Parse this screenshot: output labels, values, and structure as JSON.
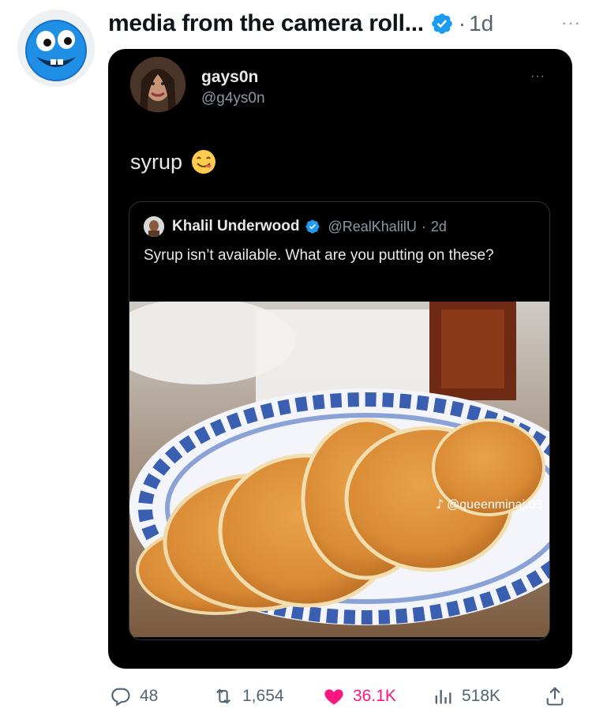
{
  "header": {
    "title": "media from the camera roll...",
    "separator": "·",
    "time": "1d",
    "more": "···"
  },
  "inner_post": {
    "display_name": "gays0n",
    "handle": "@g4ys0n",
    "more": "···",
    "text": "syrup"
  },
  "quoted_post": {
    "display_name": "Khalil Underwood",
    "handle": "@RealKhalilU",
    "separator": "·",
    "time": "2d",
    "text": "Syrup isn’t available. What are you putting on these?",
    "watermark": "@queenminaj.03"
  },
  "actions": {
    "replies": "48",
    "reposts": "1,654",
    "likes": "36.1K",
    "views": "518K"
  },
  "colors": {
    "accent": "#1d9bf0",
    "like": "#f91880",
    "muted": "#536471"
  },
  "icons": [
    "smiley-blue-avatar-icon",
    "verified-badge-icon",
    "more-icon",
    "reply-icon",
    "repost-icon",
    "heart-icon",
    "views-icon",
    "share-icon",
    "tiktok-icon",
    "yum-emoji-icon"
  ]
}
